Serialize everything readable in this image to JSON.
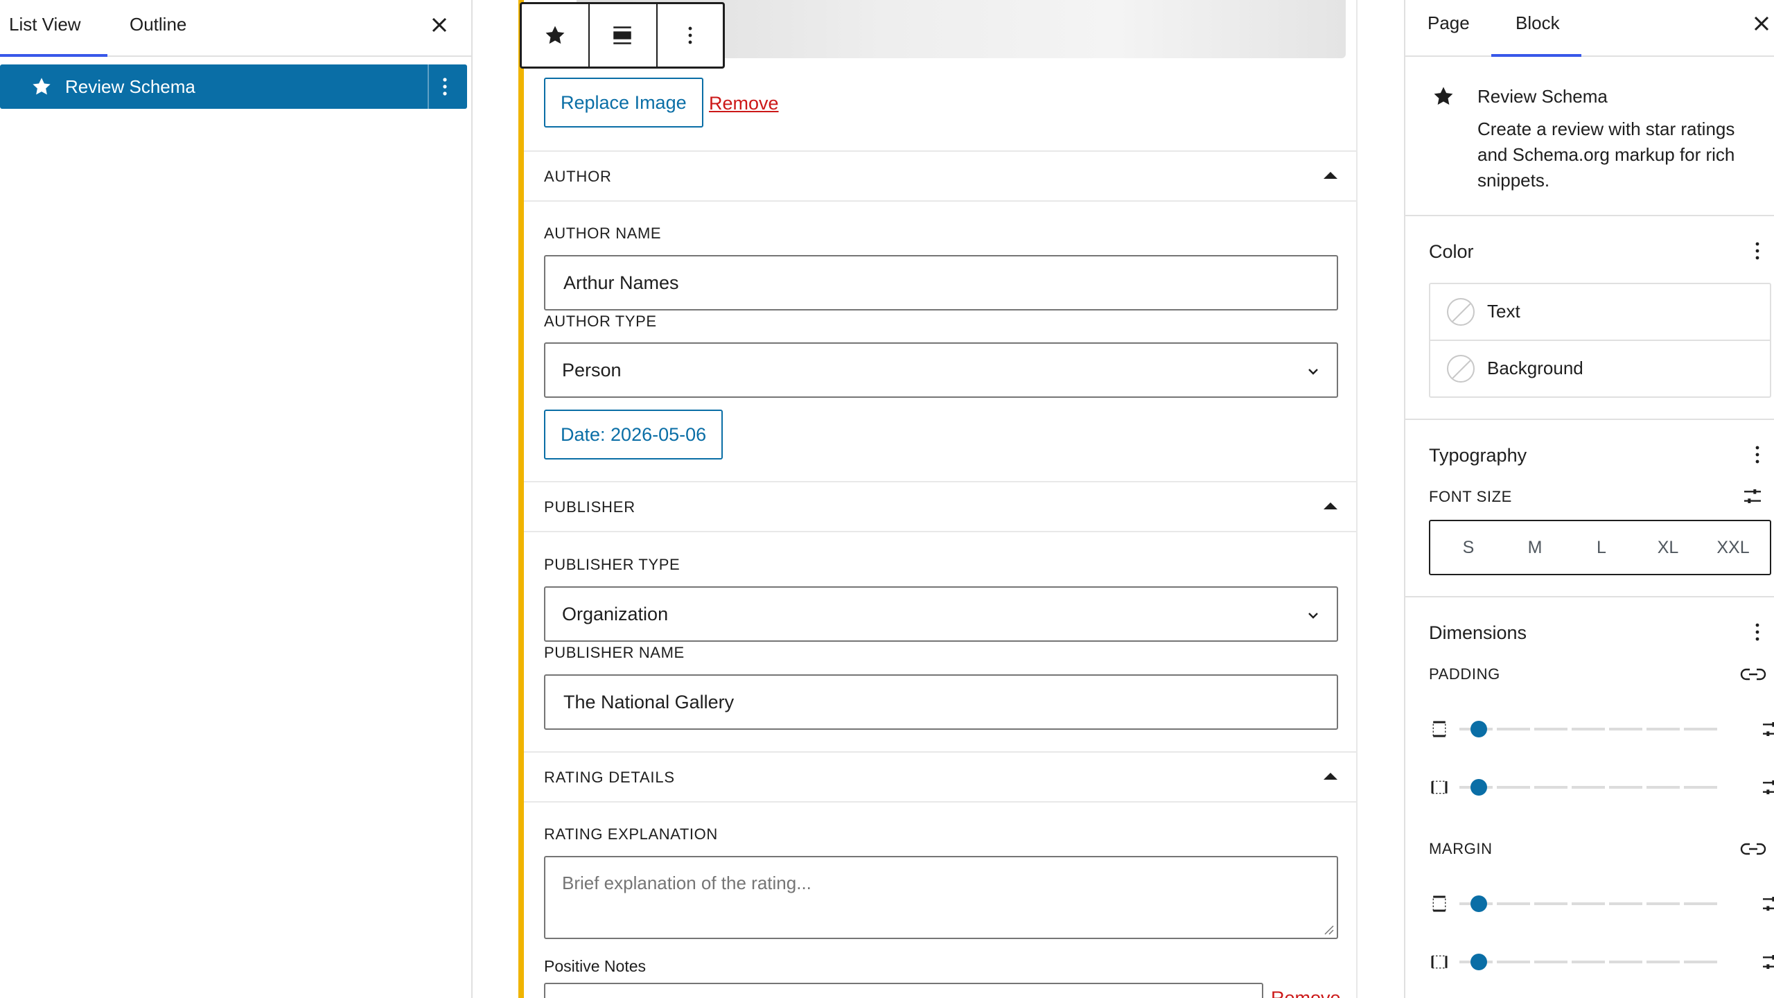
{
  "colors": {
    "accent_blue": "#0a6ea6",
    "tab_underline": "#3858e9",
    "block_accent": "#f0b400",
    "remove_red": "#cc1818"
  },
  "list_panel": {
    "tabs": [
      "List View",
      "Outline"
    ],
    "close_icon": "close-icon",
    "items": [
      {
        "label": "Review Schema",
        "icon": "star-icon",
        "selected": true
      }
    ]
  },
  "toolbar": {
    "buttons": [
      "star-icon",
      "align-full-icon",
      "more-vertical-icon"
    ]
  },
  "image": {
    "replace_label": "Replace Image",
    "remove_label": "Remove"
  },
  "author": {
    "title": "AUTHOR",
    "name_label": "AUTHOR NAME",
    "name_value": "Arthur Names",
    "type_label": "AUTHOR TYPE",
    "type_value": "Person",
    "date_button": "Date: 2026-05-06"
  },
  "publisher": {
    "title": "PUBLISHER",
    "type_label": "PUBLISHER TYPE",
    "type_value": "Organization",
    "name_label": "PUBLISHER NAME",
    "name_value": "The National Gallery"
  },
  "rating": {
    "title": "RATING DETAILS",
    "explanation_label": "RATING EXPLANATION",
    "explanation_placeholder": "Brief explanation of the rating...",
    "positive_label": "Positive Notes",
    "positive_remove": "Remove"
  },
  "sidebar": {
    "tabs": [
      "Page",
      "Block"
    ],
    "active_tab": "Block",
    "block": {
      "title": "Review Schema",
      "description": "Create a review with star ratings and Schema.org markup for rich snippets."
    },
    "color": {
      "title": "Color",
      "items": [
        "Text",
        "Background"
      ]
    },
    "typography": {
      "title": "Typography",
      "font_size_label": "FONT SIZE",
      "sizes": [
        "S",
        "M",
        "L",
        "XL",
        "XXL"
      ]
    },
    "dimensions": {
      "title": "Dimensions",
      "padding_label": "PADDING",
      "margin_label": "MARGIN"
    }
  }
}
